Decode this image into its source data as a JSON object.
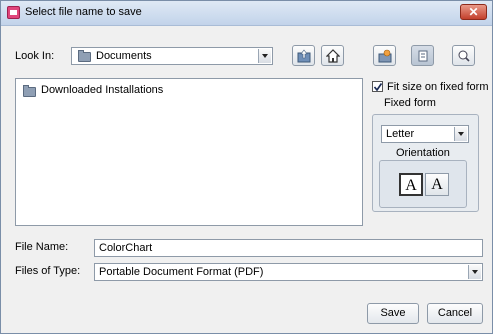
{
  "dialog": {
    "title": "Select file name to save"
  },
  "look_in": {
    "label": "Look In:",
    "value": "Documents"
  },
  "toolbar": {
    "icons": [
      "up-folder-icon",
      "home-icon",
      "new-folder-icon",
      "list-view-icon",
      "details-view-icon"
    ]
  },
  "files": [
    {
      "name": "Downloaded Installations",
      "icon": "folder-icon"
    }
  ],
  "options": {
    "fit_size_label": "Fit size on fixed form",
    "fit_size_checked": true,
    "fixed_form_label": "Fixed form",
    "paper_value": "Letter",
    "orientation_label": "Orientation",
    "orientation_selected": "portrait"
  },
  "file_name": {
    "label": "File Name:",
    "value": "ColorChart"
  },
  "file_type": {
    "label": "Files of Type:",
    "value": "Portable Document Format (PDF)"
  },
  "buttons": {
    "save": "Save",
    "cancel": "Cancel"
  },
  "colors": {
    "titlebar": "#c8d8ee",
    "close": "#c7432f",
    "app_icon": "#e0457b"
  }
}
